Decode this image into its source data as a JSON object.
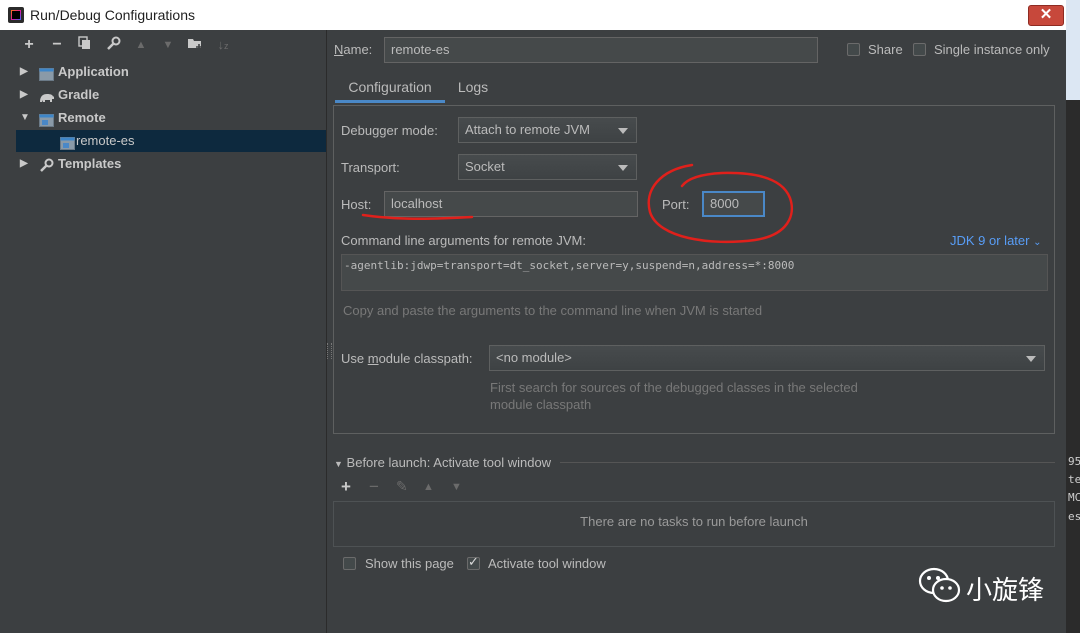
{
  "window": {
    "title": "Run/Debug Configurations",
    "close_label": "✕"
  },
  "left_toolbar": {
    "icons": [
      "add-icon",
      "remove-icon",
      "copy-icon",
      "wrench-icon",
      "move-up-icon",
      "move-down-icon",
      "folder-add-icon",
      "sort-icon"
    ]
  },
  "tree": {
    "items": [
      {
        "label": "Application",
        "expanded": false
      },
      {
        "label": "Gradle",
        "expanded": false
      },
      {
        "label": "Remote",
        "expanded": true
      },
      {
        "label": "remote-es",
        "selected": true
      },
      {
        "label": "Templates",
        "expanded": false
      }
    ]
  },
  "name_row": {
    "label_prefix": "N",
    "label_rest": "ame:",
    "value": "remote-es",
    "share_label": "Share",
    "single_instance_label": "Single instance only"
  },
  "tabs": {
    "configuration": "Configuration",
    "logs": "Logs"
  },
  "config": {
    "debugger_mode_label": "Debugger mode:",
    "debugger_mode_value": "Attach to remote JVM",
    "transport_label": "Transport:",
    "transport_value": "Socket",
    "host_label": "Host:",
    "host_value": "localhost",
    "port_label": "Port:",
    "port_value": "8000",
    "cmdline_label": "Command line arguments for remote JVM:",
    "jdk_link": "JDK 9 or later",
    "cmdline_value": "-agentlib:jdwp=transport=dt_socket,server=y,suspend=n,address=*:8000",
    "cmdline_hint": "Copy and paste the arguments to the command line when JVM is started",
    "module_label": "Use module classpath:",
    "module_value": "<no module>",
    "module_hint_1": "First search for sources of the debugged classes in the selected",
    "module_hint_2": "module classpath"
  },
  "before_launch": {
    "header": "Before launch: Activate tool window",
    "empty_text": "There are no tasks to run before launch",
    "show_page_label": "Show this page",
    "show_page_checked": false,
    "activate_label": "Activate tool window",
    "activate_checked": true
  },
  "watermark": {
    "text": "小旋锋"
  },
  "right_edge_fragments": [
    "95",
    "te",
    "MC",
    "es"
  ],
  "colors": {
    "accent": "#4a88c7",
    "annotation_red": "#e0201b",
    "selection": "#0d293e"
  }
}
